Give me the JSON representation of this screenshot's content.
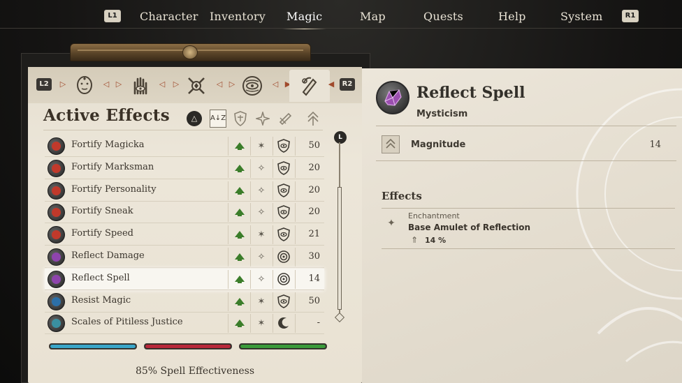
{
  "nav": {
    "left_shoulder": "L1",
    "right_shoulder": "R1",
    "items": [
      "Character",
      "Inventory",
      "Magic",
      "Map",
      "Quests",
      "Help",
      "System"
    ],
    "active": "Magic"
  },
  "tabs": {
    "left_button": "L2",
    "right_button": "R2",
    "icons": [
      "head-icon",
      "hand-eye-icon",
      "crossed-swords-icon",
      "eye-sigil-icon",
      "active-effects-icon"
    ],
    "active_index": 4
  },
  "list": {
    "title": "Active Effects",
    "sort_buttons": {
      "triangle": "△",
      "az": "A↓Z"
    },
    "rows": [
      {
        "name": "Fortify Magicka",
        "value": "50",
        "icon_color": "#c0392b",
        "col2": "✶",
        "col3": "shield-eye-icon",
        "selected": false
      },
      {
        "name": "Fortify Marksman",
        "value": "20",
        "icon_color": "#c0392b",
        "col2": "✧",
        "col3": "shield-eye-icon",
        "selected": false
      },
      {
        "name": "Fortify Personality",
        "value": "20",
        "icon_color": "#c0392b",
        "col2": "✧",
        "col3": "shield-eye-icon",
        "selected": false
      },
      {
        "name": "Fortify Sneak",
        "value": "20",
        "icon_color": "#c0392b",
        "col2": "✧",
        "col3": "shield-eye-icon",
        "selected": false
      },
      {
        "name": "Fortify Speed",
        "value": "21",
        "icon_color": "#c0392b",
        "col2": "✶",
        "col3": "shield-eye-icon",
        "selected": false
      },
      {
        "name": "Reflect Damage",
        "value": "30",
        "icon_color": "#8e44ad",
        "col2": "✧",
        "col3": "spiral-icon",
        "selected": false
      },
      {
        "name": "Reflect Spell",
        "value": "14",
        "icon_color": "#8e44ad",
        "col2": "✧",
        "col3": "spiral-icon",
        "selected": true
      },
      {
        "name": "Resist Magic",
        "value": "50",
        "icon_color": "#2c6fa8",
        "col2": "✶",
        "col3": "shield-eye-icon",
        "selected": false
      },
      {
        "name": "Scales of Pitiless Justice",
        "value": "-",
        "icon_color": "#3a8fa0",
        "col2": "✶",
        "col3": "crescent-icon",
        "selected": false
      }
    ]
  },
  "scrollbar": {
    "button": "L"
  },
  "stat_bars": [
    {
      "name": "health",
      "color": "#3aa6c9",
      "fill": 1.0
    },
    {
      "name": "magicka",
      "color": "#b8283a",
      "fill": 1.0
    },
    {
      "name": "fatigue",
      "color": "#3b9a3a",
      "fill": 1.0
    }
  ],
  "effectiveness": "85% Spell Effectiveness",
  "detail": {
    "title": "Reflect Spell",
    "school": "Mysticism",
    "magnitude_label": "Magnitude",
    "magnitude_value": "14",
    "effects_title": "Effects",
    "enchantment_label": "Enchantment",
    "enchantment_name": "Base Amulet of Reflection",
    "enchantment_pct": "14 %"
  }
}
